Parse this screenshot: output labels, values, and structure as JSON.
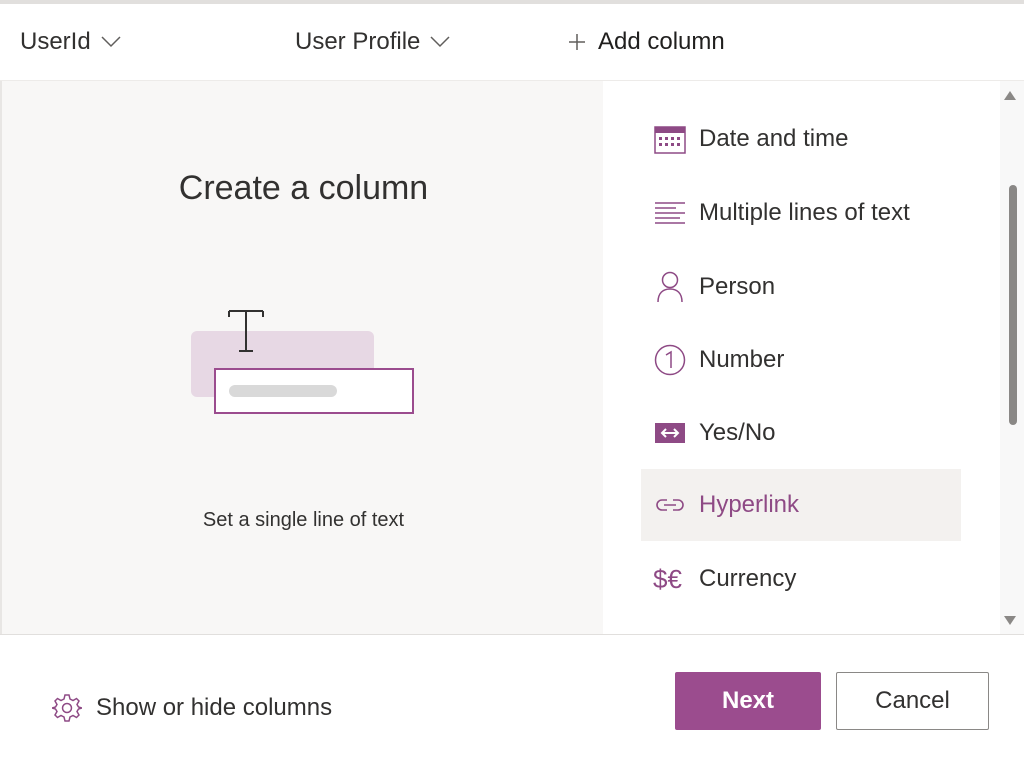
{
  "header": {
    "columns": [
      {
        "label": "UserId"
      },
      {
        "label": "User Profile"
      }
    ],
    "add_column": "Add column"
  },
  "panel": {
    "title": "Create a column",
    "description": "Set a single line of text",
    "types": [
      {
        "label": "Date and time",
        "icon": "calendar-icon"
      },
      {
        "label": "Multiple lines of text",
        "icon": "multiline-text-icon"
      },
      {
        "label": "Person",
        "icon": "person-icon"
      },
      {
        "label": "Number",
        "icon": "number-icon"
      },
      {
        "label": "Yes/No",
        "icon": "toggle-icon"
      },
      {
        "label": "Hyperlink",
        "icon": "link-icon",
        "selected": true
      },
      {
        "label": "Currency",
        "icon": "currency-icon"
      }
    ]
  },
  "footer": {
    "show_hide": "Show or hide columns",
    "next": "Next",
    "cancel": "Cancel"
  },
  "colors": {
    "accent": "#9b4c8e",
    "selected_text": "#8e4a85",
    "left_panel_bg": "#f8f7f6"
  }
}
